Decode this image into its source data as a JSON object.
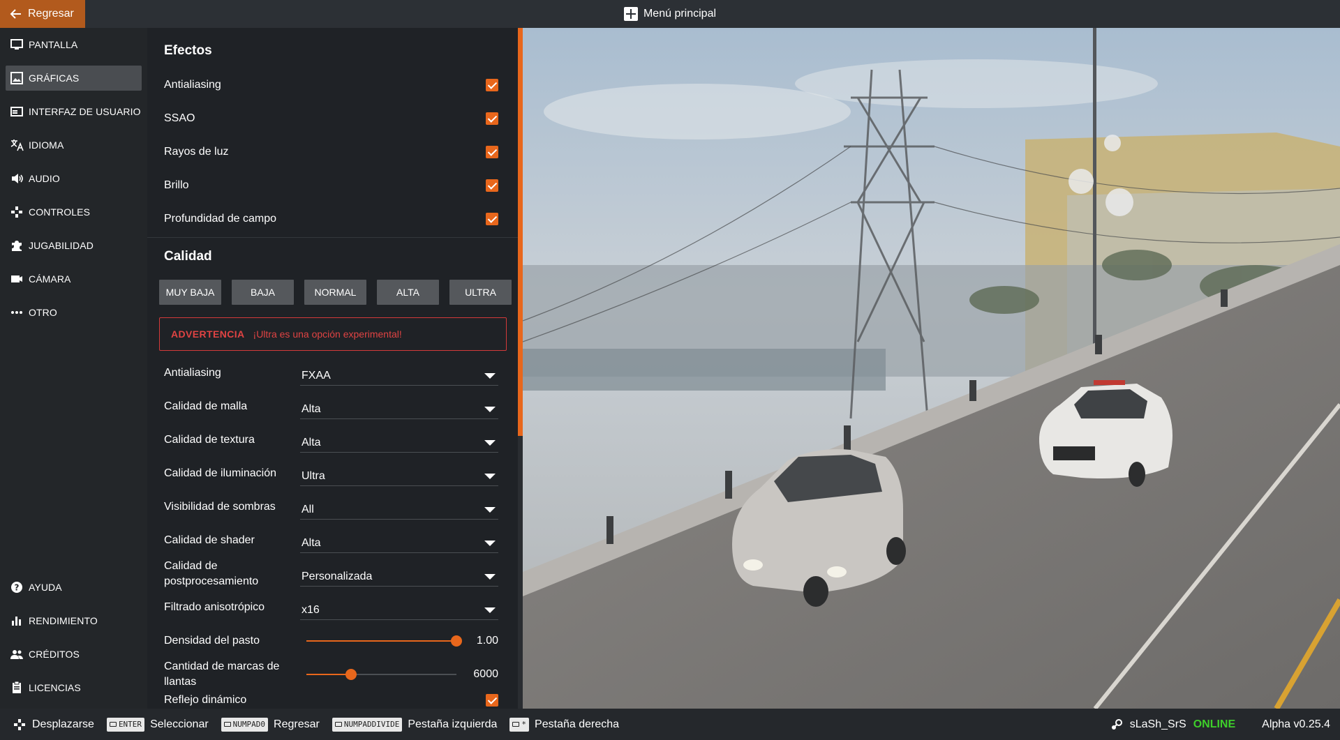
{
  "header": {
    "back_label": "Regresar",
    "title": "Menú principal"
  },
  "sidebar": {
    "items": [
      {
        "label": "PANTALLA",
        "icon": "monitor-icon"
      },
      {
        "label": "GRÁFICAS",
        "icon": "image-icon",
        "active": true
      },
      {
        "label": "INTERFAZ DE USUARIO",
        "icon": "interface-icon"
      },
      {
        "label": "IDIOMA",
        "icon": "translate-icon"
      },
      {
        "label": "AUDIO",
        "icon": "speaker-icon"
      },
      {
        "label": "CONTROLES",
        "icon": "gamepad-icon"
      },
      {
        "label": "JUGABILIDAD",
        "icon": "puzzle-icon"
      },
      {
        "label": "CÁMARA",
        "icon": "camera-icon"
      },
      {
        "label": "OTRO",
        "icon": "more-icon"
      }
    ],
    "bottom_items": [
      {
        "label": "AYUDA",
        "icon": "help-icon"
      },
      {
        "label": "RENDIMIENTO",
        "icon": "chart-icon"
      },
      {
        "label": "CRÉDITOS",
        "icon": "people-icon"
      },
      {
        "label": "LICENCIAS",
        "icon": "clipboard-icon"
      }
    ]
  },
  "effects": {
    "title": "Efectos",
    "items": [
      {
        "label": "Antialiasing",
        "checked": true
      },
      {
        "label": "SSAO",
        "checked": true
      },
      {
        "label": "Rayos de luz",
        "checked": true
      },
      {
        "label": "Brillo",
        "checked": true
      },
      {
        "label": "Profundidad de campo",
        "checked": true
      }
    ]
  },
  "quality": {
    "title": "Calidad",
    "presets": [
      "MUY BAJA",
      "BAJA",
      "NORMAL",
      "ALTA",
      "ULTRA"
    ],
    "warning_label": "ADVERTENCIA",
    "warning_text": "¡Ultra es una opción experimental!",
    "selects": [
      {
        "label": "Antialiasing",
        "value": "FXAA"
      },
      {
        "label": "Calidad de malla",
        "value": "Alta"
      },
      {
        "label": "Calidad de textura",
        "value": "Alta"
      },
      {
        "label": "Calidad de iluminación",
        "value": "Ultra"
      },
      {
        "label": "Visibilidad de sombras",
        "value": "All"
      },
      {
        "label": "Calidad de shader",
        "value": "Alta"
      },
      {
        "label": "Calidad de postprocesamiento",
        "value": "Personalizada"
      },
      {
        "label": "Filtrado anisotrópico",
        "value": "x16"
      }
    ],
    "sliders": [
      {
        "label": "Densidad del pasto",
        "value": "1.00",
        "fraction": 1.0
      },
      {
        "label": "Cantidad de marcas de llantas",
        "value": "6000",
        "fraction": 0.3
      }
    ],
    "partial_item": "Reflejo dinámico"
  },
  "bottom_bar": {
    "hints": [
      {
        "key": "",
        "label": "Desplazarse",
        "icon": "gamepad-icon"
      },
      {
        "key": "ENTER",
        "label": "Seleccionar"
      },
      {
        "key": "NUMPAD0",
        "label": "Regresar"
      },
      {
        "key": "NUMPADDIVIDE",
        "label": "Pestaña izquierda"
      },
      {
        "key": "*",
        "label": "Pestaña derecha"
      }
    ],
    "username": "sLaSh_SrS",
    "status": "ONLINE",
    "version": "Alpha v0.25.4"
  },
  "colors": {
    "accent": "#e8671c",
    "warning": "#e04343",
    "online": "#3ecf2a"
  }
}
